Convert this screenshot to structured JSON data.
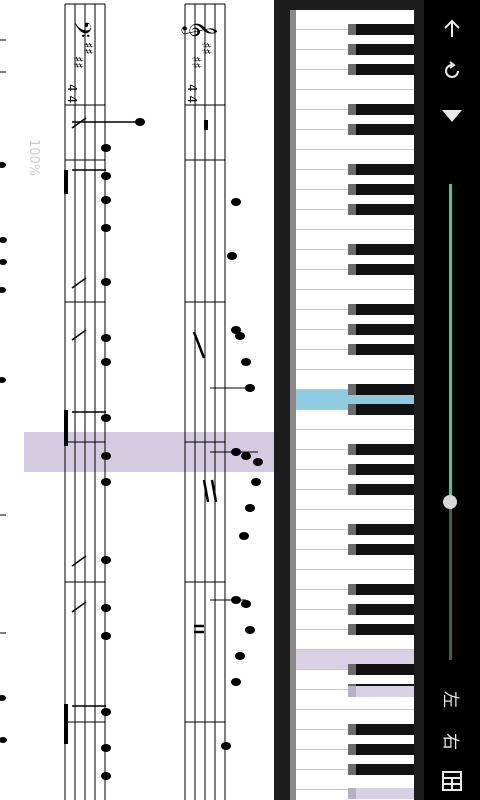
{
  "controls": {
    "back_icon": "arrow-up-icon",
    "rotate_icon": "refresh-icon",
    "speed_icon": "triangle-down-icon",
    "zoom_label": "100%",
    "zoom_value": 1.0,
    "slider_position": 0.67,
    "left_hand_label": "左",
    "right_hand_label": "右",
    "menu_icon": "grid-menu-icon"
  },
  "piano": {
    "highlighted_blue_key": "white",
    "highlighted_lavender_keys": [
      "white",
      "black",
      "black"
    ],
    "highlight_colors": {
      "blue": "#8ecbe0",
      "lavender": "#d9d0e6"
    }
  },
  "sheet": {
    "highlight_color": "#d4cbe0",
    "clef_bass": "𝄢",
    "clef_treble": "𝄞",
    "accent_color": "#2fd39a"
  }
}
